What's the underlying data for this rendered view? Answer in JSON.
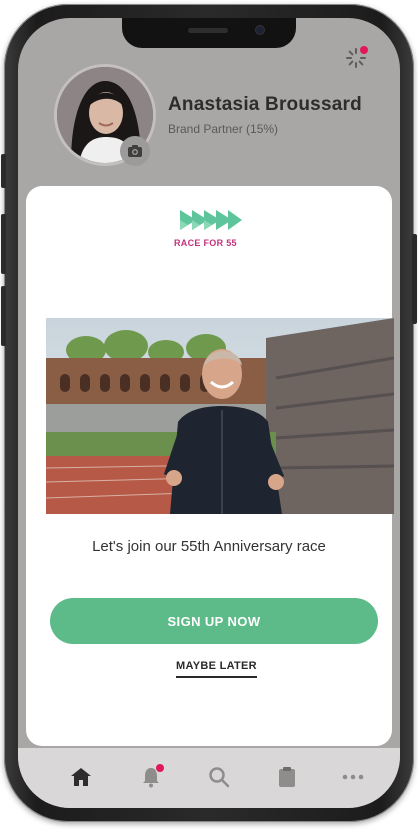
{
  "profile": {
    "name": "Anastasia Broussard",
    "role": "Brand Partner (15%)"
  },
  "promo": {
    "logo_text": "RACE FOR 55",
    "tagline": "Let's join our 55th Anniversary race",
    "signup_label": "SIGN UP NOW",
    "maybe_later_label": "MAYBE LATER"
  },
  "tabbar": {
    "items": [
      "home-icon",
      "notifications-icon",
      "search-icon",
      "clipboard-icon",
      "more-icon"
    ],
    "active": "home-icon"
  },
  "colors": {
    "accent_green": "#5dbb8a",
    "logo_green": "#5ec49a",
    "brand_pink": "#c2327c",
    "badge_red": "#e2175a"
  }
}
